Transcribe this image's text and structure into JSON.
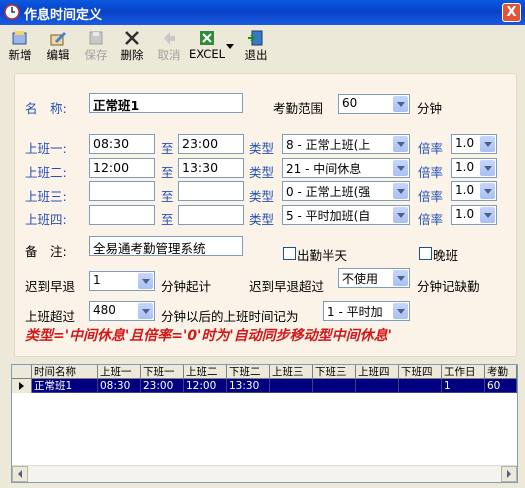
{
  "window": {
    "title": "作息时间定义",
    "close_glyph": "X"
  },
  "toolbar": {
    "new": "新增",
    "edit": "编辑",
    "save": "保存",
    "delete": "删除",
    "cancel": "取消",
    "excel": "EXCEL",
    "exit": "退出"
  },
  "form": {
    "name_label": "名　称:",
    "name_value": "正常班1",
    "range_label": "考勤范围",
    "range_value": "60",
    "range_unit": "分钟",
    "shifts": [
      {
        "label": "上班一:",
        "start": "08:30",
        "to": "至",
        "end": "23:00",
        "type_label": "类型",
        "type": "8 - 正常上班(上",
        "rate_label": "倍率",
        "rate": "1.0"
      },
      {
        "label": "上班二:",
        "start": "12:00",
        "to": "至",
        "end": "13:30",
        "type_label": "类型",
        "type": "21 - 中间休息",
        "rate_label": "倍率",
        "rate": "1.0"
      },
      {
        "label": "上班三:",
        "start": "",
        "to": "至",
        "end": "",
        "type_label": "类型",
        "type": "0 - 正常上班(强",
        "rate_label": "倍率",
        "rate": "1.0"
      },
      {
        "label": "上班四:",
        "start": "",
        "to": "至",
        "end": "",
        "type_label": "类型",
        "type": "5 - 平时加班(自",
        "rate_label": "倍率",
        "rate": "1.0"
      }
    ],
    "note_label": "备　注:",
    "note_value": "全易通考勤管理系统",
    "half_day_label": "出勤半天",
    "night_label": "晚班",
    "late_label": "迟到早退",
    "late_value": "1",
    "late_unit": "分钟起计",
    "over_label": "迟到早退超过",
    "over_value": "不使用",
    "over_unit": "分钟记缺勤",
    "shift_over_label": "上班超过",
    "shift_over_value": "480",
    "shift_over_unit": "分钟以后的上班时间记为",
    "shift_over_type": "1 - 平时加",
    "note_red": "类型='中间休息'且倍率='0'时为'自动同步移动型中间休息'"
  },
  "grid": {
    "columns": [
      "时间名称",
      "上班一",
      "下班一",
      "上班二",
      "下班二",
      "上班三",
      "下班三",
      "上班四",
      "下班四",
      "工作日",
      "考勤"
    ],
    "rows": [
      [
        "正常班1",
        "08:30",
        "23:00",
        "12:00",
        "13:30",
        "",
        "",
        "",
        "",
        "1",
        "60"
      ]
    ]
  },
  "colors": {
    "accent": "#2451b5",
    "title_bar": "#0842c8",
    "note": "#d21818",
    "selection": "#000080"
  }
}
